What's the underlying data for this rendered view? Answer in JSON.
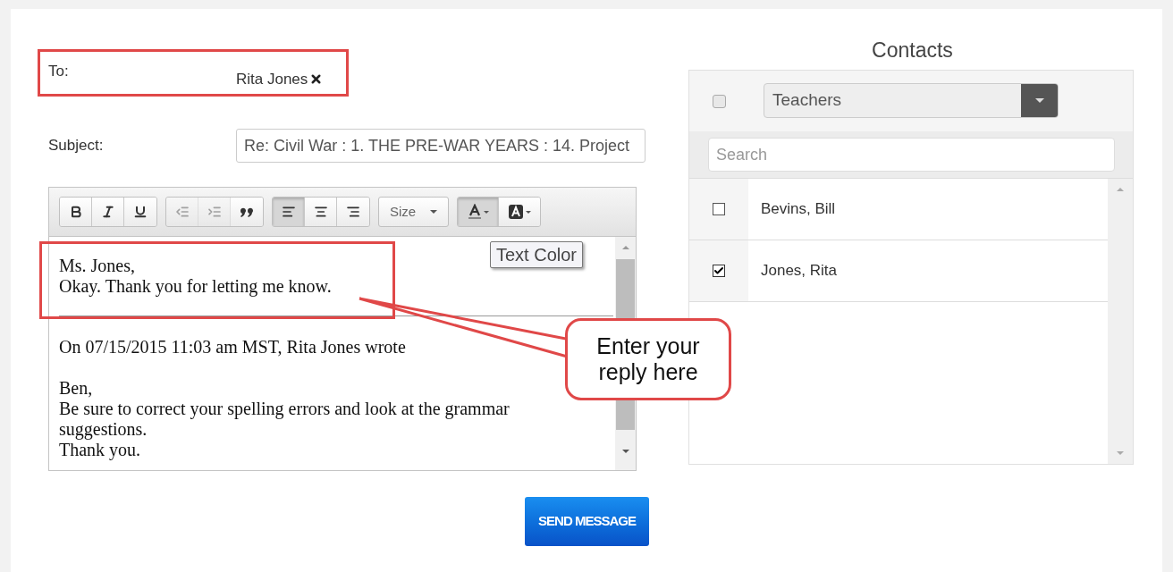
{
  "to": {
    "label": "To:",
    "recipients": [
      {
        "name": "Rita Jones"
      }
    ]
  },
  "subject": {
    "label": "Subject:",
    "value": "Re: Civil War : 1. THE PRE-WAR YEARS : 14. Project"
  },
  "editor": {
    "toolbar": {
      "groups": [
        [
          {
            "selected": false,
            "disabled": false
          },
          {
            "selected": false,
            "disabled": false
          },
          {
            "selected": false,
            "disabled": false
          }
        ],
        [
          {
            "selected": false,
            "disabled": true
          },
          {
            "selected": false,
            "disabled": true
          },
          {
            "selected": false,
            "disabled": false
          }
        ],
        [
          {
            "selected": true,
            "disabled": false
          },
          {
            "selected": false,
            "disabled": false
          },
          {
            "selected": false,
            "disabled": false
          }
        ]
      ],
      "size": "Size",
      "color_buttons": [
        {
          "selected": true,
          "disabled": false
        },
        {
          "selected": false,
          "disabled": false
        }
      ]
    },
    "tooltip": "Text Color",
    "reply": [
      "Ms. Jones,",
      "Okay. Thank you for letting me know."
    ],
    "quote": {
      "header": "On 07/15/2015 11:03 am MST, Rita Jones wrote",
      "body": [
        "Ben,",
        "Be sure to correct your spelling errors and look at the grammar suggestions.",
        "Thank you."
      ]
    }
  },
  "send_button": "SEND MESSAGE",
  "contacts": {
    "title": "Contacts",
    "select_all": {
      "checked": false
    },
    "group": "Teachers",
    "search": {
      "placeholder": "Search"
    },
    "items": [
      {
        "name": "Bevins, Bill",
        "checked": false
      },
      {
        "name": "Jones, Rita",
        "checked": true
      }
    ]
  },
  "callout": {
    "text": "Enter your reply here"
  }
}
